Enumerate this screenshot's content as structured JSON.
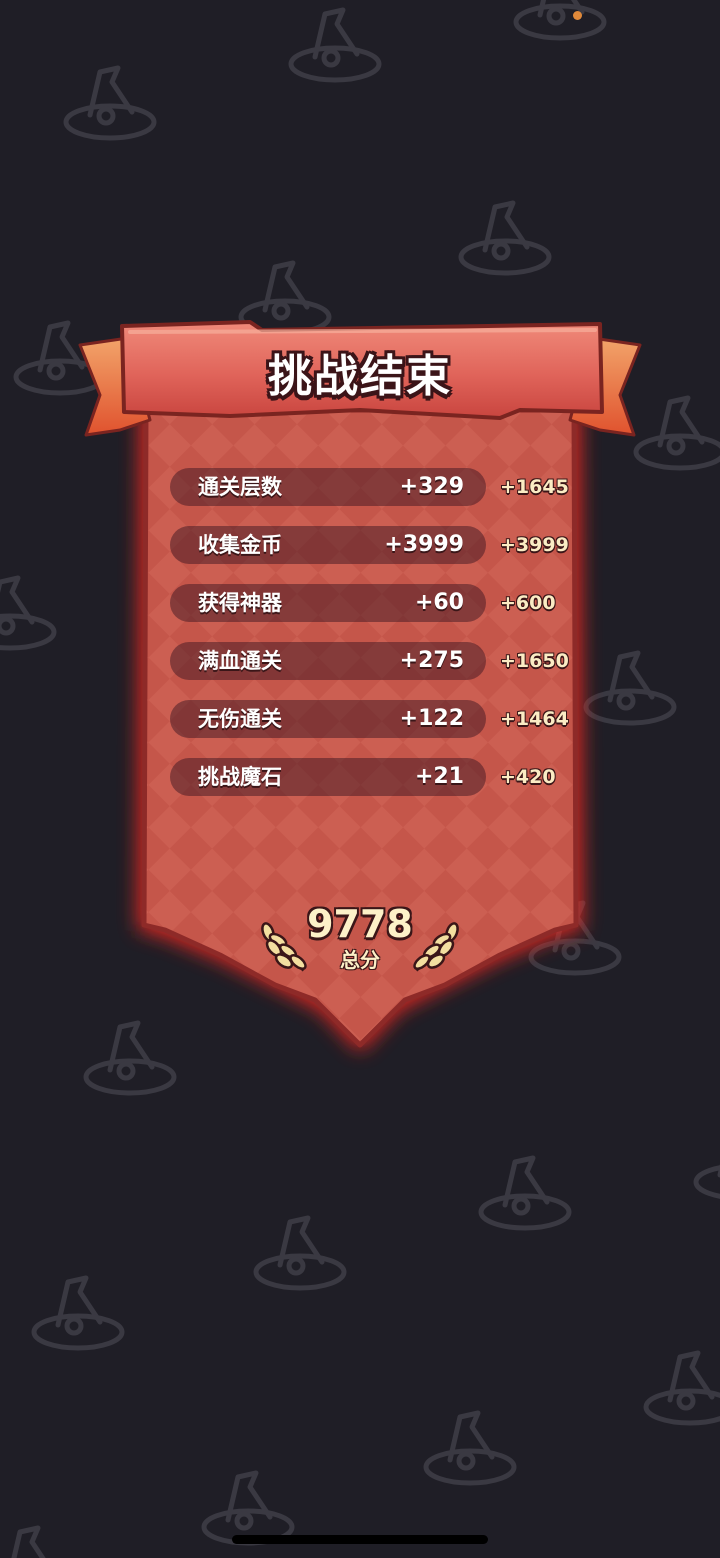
{
  "title": "挑战结束",
  "rows": [
    {
      "label": "通关层数",
      "count": "+329",
      "points": "+1645"
    },
    {
      "label": "收集金币",
      "count": "+3999",
      "points": "+3999"
    },
    {
      "label": "获得神器",
      "count": "+60",
      "points": "+600"
    },
    {
      "label": "满血通关",
      "count": "+275",
      "points": "+1650"
    },
    {
      "label": "无伤通关",
      "count": "+122",
      "points": "+1464"
    },
    {
      "label": "挑战魔石",
      "count": "+21",
      "points": "+420"
    }
  ],
  "total": {
    "value": "9778",
    "label": "总分"
  },
  "icons": {
    "background_pattern": "witch-hat-icon",
    "total_decoration": "laurel-icon"
  },
  "colors": {
    "background": "#1f1e26",
    "banner_red": "#c9584d",
    "ribbon": "#e8623d",
    "glow": "#ff2a24",
    "score_text": "#fbecc4"
  }
}
